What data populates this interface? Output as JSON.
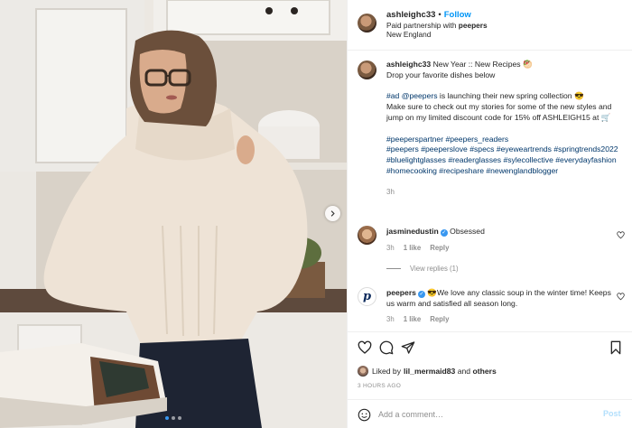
{
  "photo": {
    "carousel_dots": 3,
    "active_dot": 0
  },
  "header": {
    "username": "ashleighc33",
    "separator": "•",
    "follow_label": "Follow",
    "partnership_prefix": "Paid partnership with ",
    "partner": "peepers",
    "location": "New England"
  },
  "caption": {
    "username": "ashleighc33",
    "line1": "New Year :: New Recipes 🥙",
    "line2": "Drop your favorite dishes below",
    "ad_tag": "#ad",
    "mention": "@peepers",
    "line3_rest": " is launching their new spring collection 😎",
    "line4": "Make sure to check out my stories for some of the new styles and jump on my limited discount code for 15% off ASHLEIGH15 at 🛒",
    "hashtags_1": "#peeperspartner #peepers_readers",
    "hashtags_2": "#peepers #peeperslove #specs #eyeweartrends #springtrends2022 #bluelightglasses #readerglasses #sylecollective #everydayfashion #homecooking #recipeshare #newenglandblogger",
    "time": "3h"
  },
  "comments": [
    {
      "username": "jasminedustin",
      "text": "Obsessed",
      "time": "3h",
      "likes": "1 like",
      "reply": "Reply"
    },
    {
      "username": "peepers",
      "text": "😎We love any classic soup in the winter time! Keeps us warm and satisfied all season long.",
      "time": "3h",
      "likes": "1 like",
      "reply": "Reply"
    }
  ],
  "view_replies": "View replies (1)",
  "likes": {
    "prefix": "Liked by ",
    "user": "lil_mermaid83",
    "middle": " and ",
    "others": "others"
  },
  "time_ago": "3 HOURS AGO",
  "add_comment": {
    "placeholder": "Add a comment…",
    "post_label": "Post"
  },
  "colors": {
    "accent": "#0095f6",
    "link": "#00376b",
    "muted": "#8e8e8e",
    "post_disabled": "#b2dffc"
  }
}
